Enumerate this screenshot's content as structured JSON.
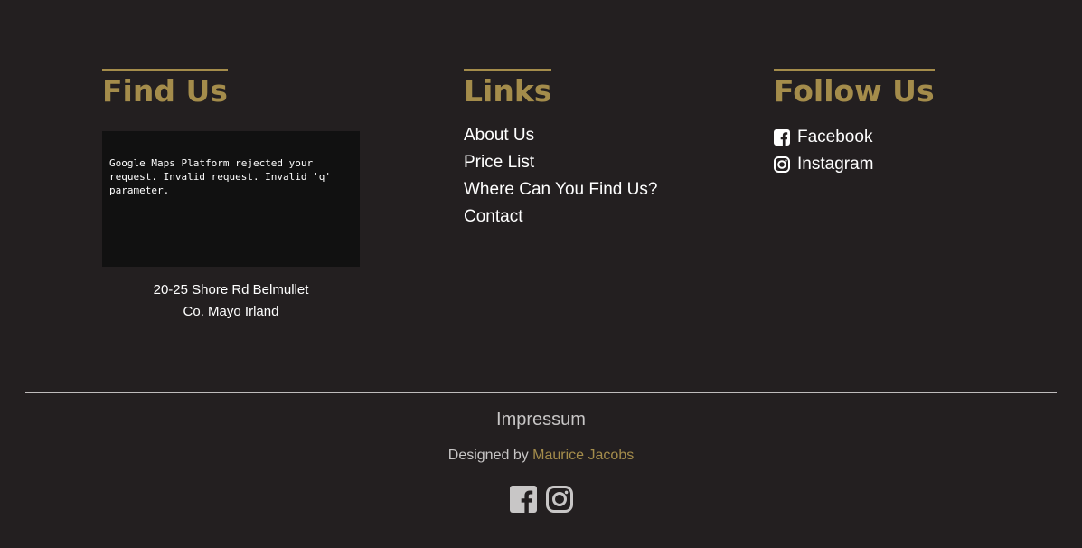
{
  "find_us": {
    "heading": "Find Us",
    "map_error": "Google Maps Platform rejected your\nrequest. Invalid request. Invalid 'q'\nparameter.",
    "address_line1": "20-25 Shore Rd Belmullet",
    "address_line2": "Co. Mayo Irland"
  },
  "links": {
    "heading": "Links",
    "items": [
      {
        "label": "About Us"
      },
      {
        "label": "Price List"
      },
      {
        "label": "Where Can You Find Us?"
      },
      {
        "label": "Contact"
      }
    ]
  },
  "follow_us": {
    "heading": "Follow Us",
    "items": [
      {
        "label": "Facebook",
        "icon": "facebook-icon"
      },
      {
        "label": "Instagram",
        "icon": "instagram-icon"
      }
    ]
  },
  "footer": {
    "impressum": "Impressum",
    "designed_by": "Designed by",
    "author": "Maurice Jacobs",
    "icons": [
      "facebook-icon",
      "instagram-icon"
    ]
  },
  "colors": {
    "background": "#231f20",
    "accent": "#a48c4b",
    "text": "#ffffff",
    "muted": "#c8c6c6",
    "map_bg": "#111111"
  }
}
